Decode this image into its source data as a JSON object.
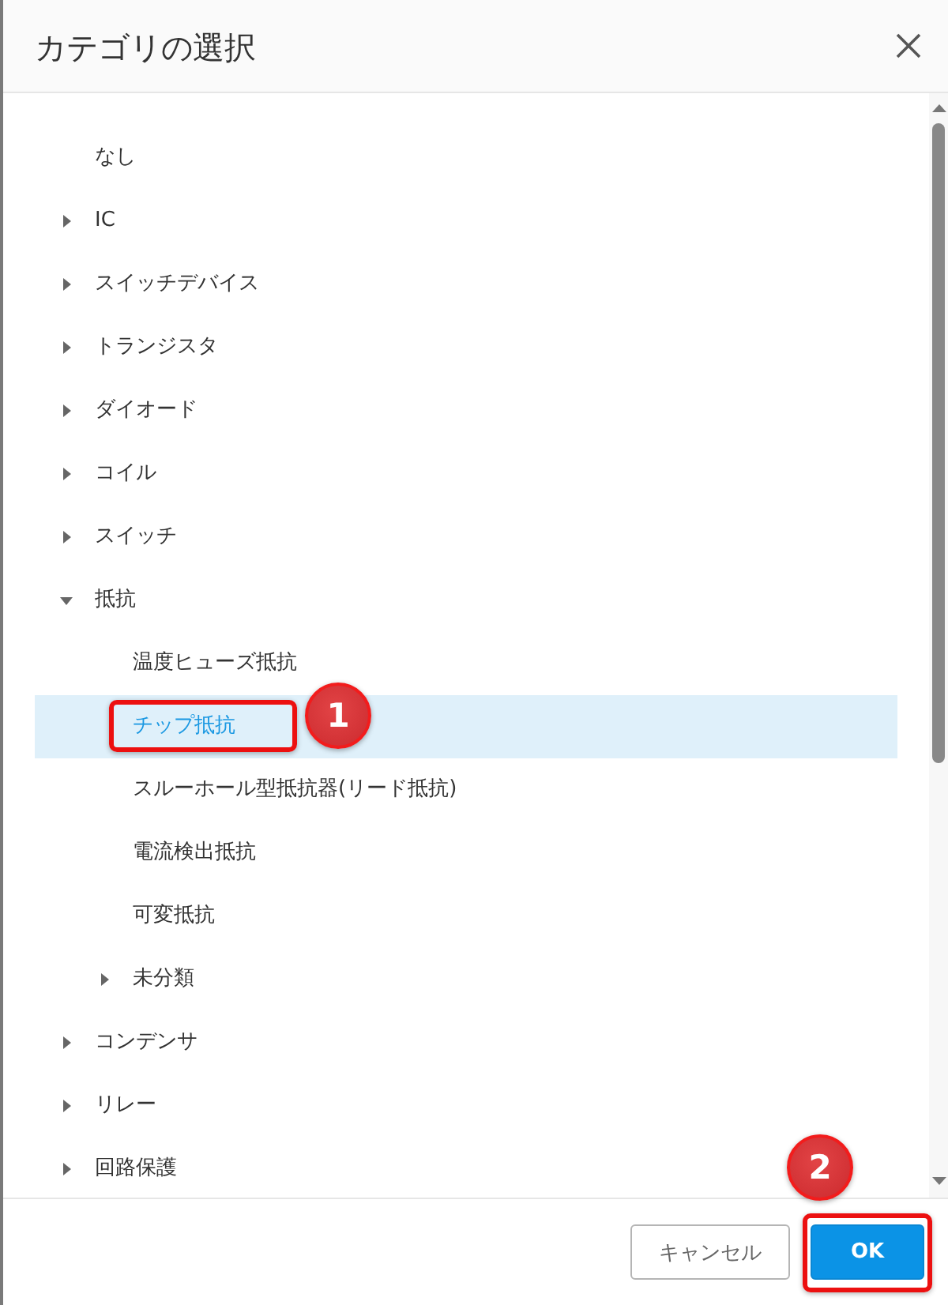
{
  "dialog": {
    "title": "カテゴリの選択"
  },
  "tree": [
    {
      "label": "なし",
      "selected": false
    },
    {
      "label": "IC",
      "selected": false,
      "expanded": false
    },
    {
      "label": "スイッチデバイス",
      "selected": false,
      "expanded": false
    },
    {
      "label": "トランジスタ",
      "selected": false,
      "expanded": false
    },
    {
      "label": "ダイオード",
      "selected": false,
      "expanded": false
    },
    {
      "label": "コイル",
      "selected": false,
      "expanded": false
    },
    {
      "label": "スイッチ",
      "selected": false,
      "expanded": false
    },
    {
      "label": "抵抗",
      "selected": false,
      "expanded": true,
      "children": [
        {
          "label": "温度ヒューズ抵抗",
          "selected": false
        },
        {
          "label": "チップ抵抗",
          "selected": true,
          "callout": "1"
        },
        {
          "label": "スルーホール型抵抗器(リード抵抗)",
          "selected": false
        },
        {
          "label": "電流検出抵抗",
          "selected": false
        },
        {
          "label": "可変抵抗",
          "selected": false
        },
        {
          "label": "未分類",
          "selected": false,
          "expanded": false
        }
      ]
    },
    {
      "label": "コンデンサ",
      "selected": false,
      "expanded": false
    },
    {
      "label": "リレー",
      "selected": false,
      "expanded": false
    },
    {
      "label": "回路保護",
      "selected": false,
      "expanded": false
    }
  ],
  "buttons": [
    {
      "label": "キャンセル",
      "kind": "secondary"
    },
    {
      "label": "OK",
      "kind": "primary",
      "callout": "2"
    }
  ]
}
